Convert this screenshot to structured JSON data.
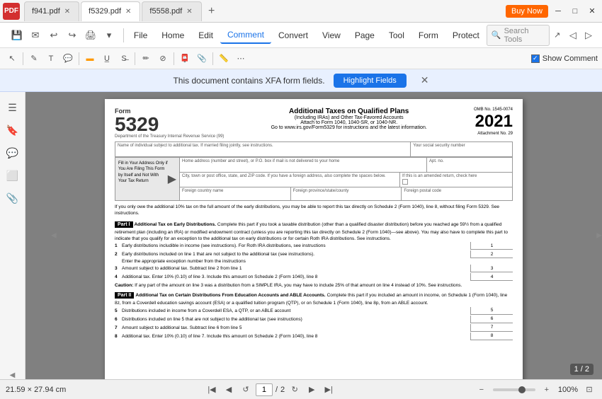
{
  "app": {
    "icon": "PDF",
    "tabs": [
      {
        "id": "tab1",
        "label": "f941.pdf",
        "active": false
      },
      {
        "id": "tab2",
        "label": "f5329.pdf",
        "active": true
      },
      {
        "id": "tab3",
        "label": "f5558.pdf",
        "active": false
      }
    ],
    "buy_now": "Buy Now",
    "win_buttons": [
      "─",
      "□",
      "✕"
    ]
  },
  "menu": {
    "items": [
      "File",
      "Home",
      "Edit",
      "Comment",
      "Convert",
      "View",
      "Page",
      "Tool",
      "Form",
      "Protect"
    ],
    "active": "Comment",
    "search_placeholder": "Search Tools"
  },
  "comment_toolbar": {
    "icons": [
      "✏",
      "T",
      "⬛",
      "☁",
      "✎",
      "📌",
      "⟲",
      "🖊",
      "➡",
      "💬",
      "✍",
      "▦",
      "🔧",
      "📎"
    ],
    "show_comment_label": "Show Comment"
  },
  "banner": {
    "text": "This document contains XFA form fields.",
    "button": "Highlight Fields",
    "close": "✕"
  },
  "sidebar": {
    "icons": [
      "☰",
      "🔖",
      "💬",
      "🖼",
      "📎"
    ]
  },
  "form": {
    "number_label": "Form",
    "number": "5329",
    "dept": "Department of the Treasury  Internal Revenue Service (99)",
    "title_main": "Additional Taxes on Qualified Plans",
    "title_sub1": "(Including IRAs) and Other Tax-Favored Accounts",
    "attach_line1": "Attach to Form 1040, 1040-SR, or 1040-NR.",
    "attach_line2": "Go to www.irs.gov/Form5329 for instructions and the latest information.",
    "omb_label": "OMB No. 1545-0074",
    "year": "2021",
    "attachment_no": "Attachment No. 29",
    "fields": {
      "name_label": "Name of individual subject to additional tax. If married filing jointly, see instructions.",
      "ssn_label": "Your social security number",
      "address_label": "Home address (number and street), or P.O. box if mail is not delivered to your home",
      "apt_label": "Apt. no.",
      "city_label": "City, town or post office, state, and ZIP code. If you have a foreign address, also complete the spaces below.",
      "amended_label": "If this is an amended return, check here",
      "country_label": "Foreign country name",
      "province_label": "Foreign province/state/county",
      "postal_label": "Foreign postal code"
    },
    "fill_box": {
      "text": "Fill in Your Address Only if You Are Filing This Form by Itself and Not With Your Tax Return",
      "arrow": "▶"
    },
    "note": "If you only owe the additional 10% tax on the full amount of the early distributions, you may be able to report this tax directly on Schedule 2 (Form 1040), line 8, without filing Form 5329. See instructions.",
    "part1": {
      "label": "Part I",
      "title": "Additional Tax on Early Distributions.",
      "desc": "Complete this part if you took a taxable distribution (other than a qualified disaster distribution) before you reached age 59½ from a qualified retirement plan (including an IRA) or modified endowment contract (unless you are reporting this tax directly on Schedule 2 (Form 1040)—see above). You may also have to complete this part to indicate that you qualify for an exception to the additional tax on early distributions or for certain Roth IRA distributions. See instructions.",
      "lines": [
        {
          "num": "1",
          "text": "Early distributions includible in income (see instructions). For Roth IRA distributions, see instructions"
        },
        {
          "num": "2",
          "text": "Early distributions included on line 1 that are not subject to the additional tax (see instructions)."
        },
        {
          "num": "",
          "text": "Enter the appropriate exception number from the instructions"
        },
        {
          "num": "3",
          "text": "Amount subject to additional tax. Subtract line 2 from line 1"
        },
        {
          "num": "4",
          "text": "Additional tax. Enter 10% (0.10) of line 3. Include this amount on Schedule 2 (Form 1040), line 8"
        }
      ],
      "caution": "Caution: If any part of the amount on line 3 was a distribution from a SIMPLE IRA, you may have to include 25% of that amount on line 4 instead of 10%. See instructions."
    },
    "part2": {
      "label": "Part II",
      "title": "Additional Tax on Certain Distributions From Education Accounts and ABLE Accounts.",
      "desc": "Complete this part if you included an amount in income, on Schedule 1 (Form 1040), line 8z, from a Coverdell education savings account (ESA) or a qualified tuition program (QTP), or on Schedule 1 (Form 1040), line 8p, from an ABLE account.",
      "lines": [
        {
          "num": "5",
          "text": "Distributions included in income from a Coverdell ESA, a QTP, or an ABLE account"
        },
        {
          "num": "6",
          "text": "Distributions included on line 5 that are not subject to the additional tax (see instructions)"
        },
        {
          "num": "7",
          "text": "Amount subject to additional tax. Subtract line 6 from line 5"
        },
        {
          "num": "8",
          "text": "Additional tax. Enter 10% (0.10) of line 7. Include this amount on Schedule 2 (Form 1040), line 8"
        }
      ]
    }
  },
  "status_bar": {
    "dimensions": "21.59 × 27.94 cm",
    "current_page": "1",
    "total_pages": "2",
    "page_badge": "1 / 2",
    "zoom": "100%"
  }
}
